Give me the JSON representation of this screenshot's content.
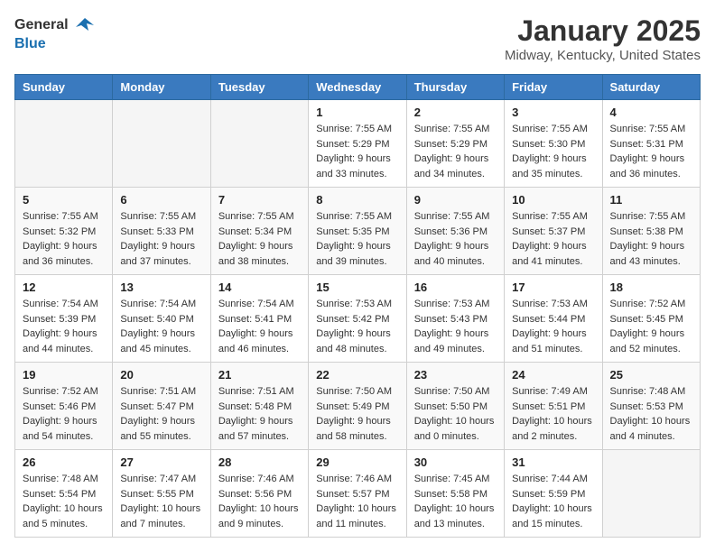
{
  "header": {
    "logo_general": "General",
    "logo_blue": "Blue",
    "month_year": "January 2025",
    "location": "Midway, Kentucky, United States"
  },
  "weekdays": [
    "Sunday",
    "Monday",
    "Tuesday",
    "Wednesday",
    "Thursday",
    "Friday",
    "Saturday"
  ],
  "weeks": [
    [
      {
        "day": "",
        "sunrise": "",
        "sunset": "",
        "daylight": ""
      },
      {
        "day": "",
        "sunrise": "",
        "sunset": "",
        "daylight": ""
      },
      {
        "day": "",
        "sunrise": "",
        "sunset": "",
        "daylight": ""
      },
      {
        "day": "1",
        "sunrise": "Sunrise: 7:55 AM",
        "sunset": "Sunset: 5:29 PM",
        "daylight": "Daylight: 9 hours and 33 minutes."
      },
      {
        "day": "2",
        "sunrise": "Sunrise: 7:55 AM",
        "sunset": "Sunset: 5:29 PM",
        "daylight": "Daylight: 9 hours and 34 minutes."
      },
      {
        "day": "3",
        "sunrise": "Sunrise: 7:55 AM",
        "sunset": "Sunset: 5:30 PM",
        "daylight": "Daylight: 9 hours and 35 minutes."
      },
      {
        "day": "4",
        "sunrise": "Sunrise: 7:55 AM",
        "sunset": "Sunset: 5:31 PM",
        "daylight": "Daylight: 9 hours and 36 minutes."
      }
    ],
    [
      {
        "day": "5",
        "sunrise": "Sunrise: 7:55 AM",
        "sunset": "Sunset: 5:32 PM",
        "daylight": "Daylight: 9 hours and 36 minutes."
      },
      {
        "day": "6",
        "sunrise": "Sunrise: 7:55 AM",
        "sunset": "Sunset: 5:33 PM",
        "daylight": "Daylight: 9 hours and 37 minutes."
      },
      {
        "day": "7",
        "sunrise": "Sunrise: 7:55 AM",
        "sunset": "Sunset: 5:34 PM",
        "daylight": "Daylight: 9 hours and 38 minutes."
      },
      {
        "day": "8",
        "sunrise": "Sunrise: 7:55 AM",
        "sunset": "Sunset: 5:35 PM",
        "daylight": "Daylight: 9 hours and 39 minutes."
      },
      {
        "day": "9",
        "sunrise": "Sunrise: 7:55 AM",
        "sunset": "Sunset: 5:36 PM",
        "daylight": "Daylight: 9 hours and 40 minutes."
      },
      {
        "day": "10",
        "sunrise": "Sunrise: 7:55 AM",
        "sunset": "Sunset: 5:37 PM",
        "daylight": "Daylight: 9 hours and 41 minutes."
      },
      {
        "day": "11",
        "sunrise": "Sunrise: 7:55 AM",
        "sunset": "Sunset: 5:38 PM",
        "daylight": "Daylight: 9 hours and 43 minutes."
      }
    ],
    [
      {
        "day": "12",
        "sunrise": "Sunrise: 7:54 AM",
        "sunset": "Sunset: 5:39 PM",
        "daylight": "Daylight: 9 hours and 44 minutes."
      },
      {
        "day": "13",
        "sunrise": "Sunrise: 7:54 AM",
        "sunset": "Sunset: 5:40 PM",
        "daylight": "Daylight: 9 hours and 45 minutes."
      },
      {
        "day": "14",
        "sunrise": "Sunrise: 7:54 AM",
        "sunset": "Sunset: 5:41 PM",
        "daylight": "Daylight: 9 hours and 46 minutes."
      },
      {
        "day": "15",
        "sunrise": "Sunrise: 7:53 AM",
        "sunset": "Sunset: 5:42 PM",
        "daylight": "Daylight: 9 hours and 48 minutes."
      },
      {
        "day": "16",
        "sunrise": "Sunrise: 7:53 AM",
        "sunset": "Sunset: 5:43 PM",
        "daylight": "Daylight: 9 hours and 49 minutes."
      },
      {
        "day": "17",
        "sunrise": "Sunrise: 7:53 AM",
        "sunset": "Sunset: 5:44 PM",
        "daylight": "Daylight: 9 hours and 51 minutes."
      },
      {
        "day": "18",
        "sunrise": "Sunrise: 7:52 AM",
        "sunset": "Sunset: 5:45 PM",
        "daylight": "Daylight: 9 hours and 52 minutes."
      }
    ],
    [
      {
        "day": "19",
        "sunrise": "Sunrise: 7:52 AM",
        "sunset": "Sunset: 5:46 PM",
        "daylight": "Daylight: 9 hours and 54 minutes."
      },
      {
        "day": "20",
        "sunrise": "Sunrise: 7:51 AM",
        "sunset": "Sunset: 5:47 PM",
        "daylight": "Daylight: 9 hours and 55 minutes."
      },
      {
        "day": "21",
        "sunrise": "Sunrise: 7:51 AM",
        "sunset": "Sunset: 5:48 PM",
        "daylight": "Daylight: 9 hours and 57 minutes."
      },
      {
        "day": "22",
        "sunrise": "Sunrise: 7:50 AM",
        "sunset": "Sunset: 5:49 PM",
        "daylight": "Daylight: 9 hours and 58 minutes."
      },
      {
        "day": "23",
        "sunrise": "Sunrise: 7:50 AM",
        "sunset": "Sunset: 5:50 PM",
        "daylight": "Daylight: 10 hours and 0 minutes."
      },
      {
        "day": "24",
        "sunrise": "Sunrise: 7:49 AM",
        "sunset": "Sunset: 5:51 PM",
        "daylight": "Daylight: 10 hours and 2 minutes."
      },
      {
        "day": "25",
        "sunrise": "Sunrise: 7:48 AM",
        "sunset": "Sunset: 5:53 PM",
        "daylight": "Daylight: 10 hours and 4 minutes."
      }
    ],
    [
      {
        "day": "26",
        "sunrise": "Sunrise: 7:48 AM",
        "sunset": "Sunset: 5:54 PM",
        "daylight": "Daylight: 10 hours and 5 minutes."
      },
      {
        "day": "27",
        "sunrise": "Sunrise: 7:47 AM",
        "sunset": "Sunset: 5:55 PM",
        "daylight": "Daylight: 10 hours and 7 minutes."
      },
      {
        "day": "28",
        "sunrise": "Sunrise: 7:46 AM",
        "sunset": "Sunset: 5:56 PM",
        "daylight": "Daylight: 10 hours and 9 minutes."
      },
      {
        "day": "29",
        "sunrise": "Sunrise: 7:46 AM",
        "sunset": "Sunset: 5:57 PM",
        "daylight": "Daylight: 10 hours and 11 minutes."
      },
      {
        "day": "30",
        "sunrise": "Sunrise: 7:45 AM",
        "sunset": "Sunset: 5:58 PM",
        "daylight": "Daylight: 10 hours and 13 minutes."
      },
      {
        "day": "31",
        "sunrise": "Sunrise: 7:44 AM",
        "sunset": "Sunset: 5:59 PM",
        "daylight": "Daylight: 10 hours and 15 minutes."
      },
      {
        "day": "",
        "sunrise": "",
        "sunset": "",
        "daylight": ""
      }
    ]
  ]
}
